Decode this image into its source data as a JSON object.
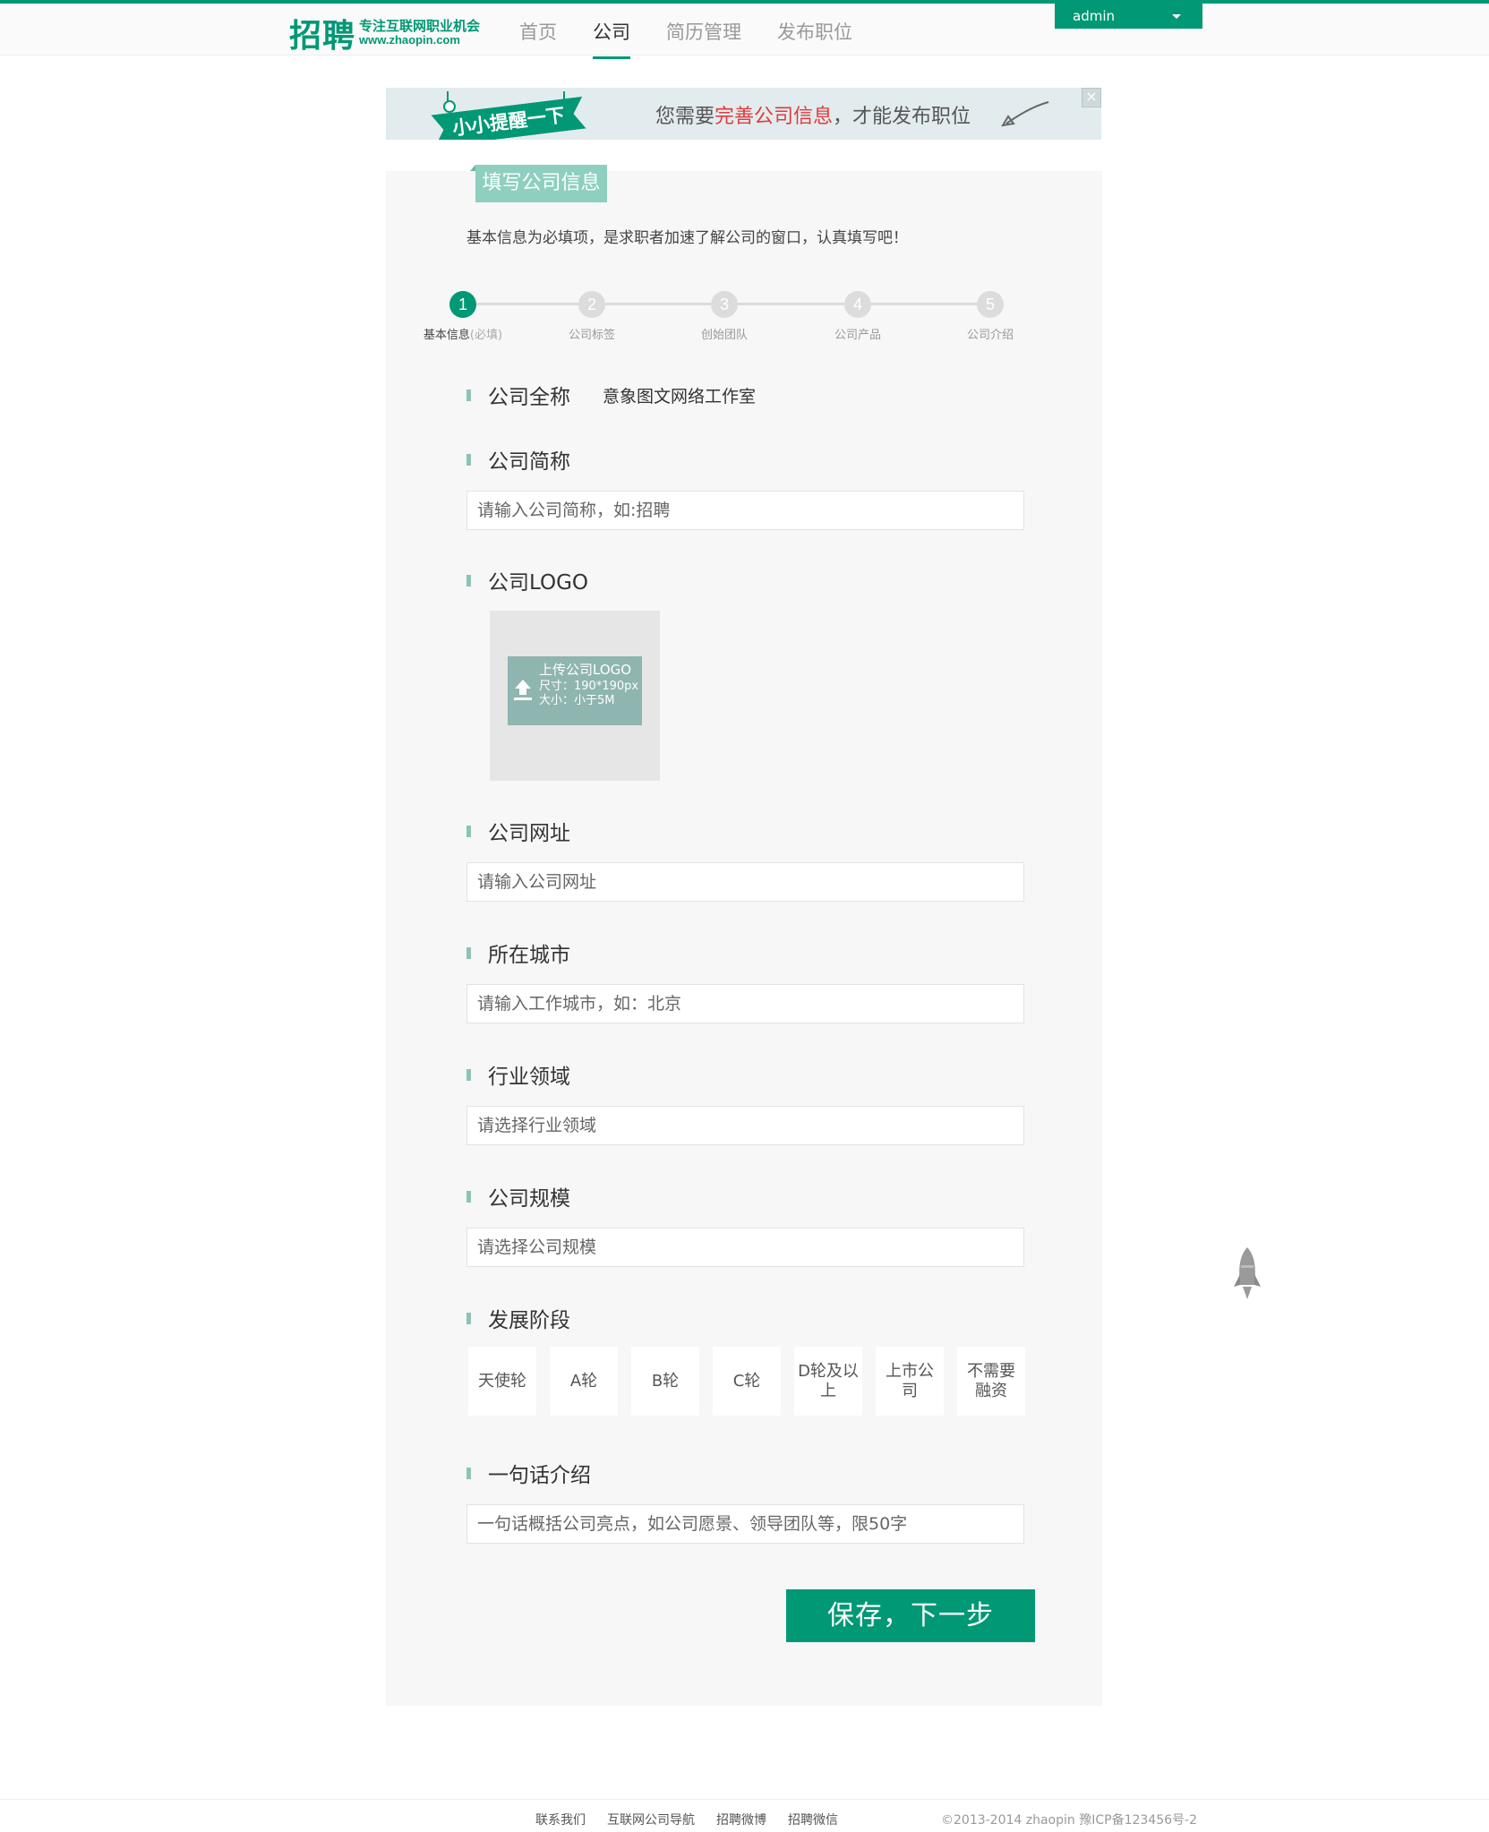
{
  "header": {
    "logo_main": "招聘",
    "logo_slogan": "专注互联网职业机会",
    "logo_url": "www.zhaopin.com",
    "nav": [
      "首页",
      "公司",
      "简历管理",
      "发布职位"
    ],
    "active_nav": "公司",
    "user": "admin",
    "brand_color": "#019875"
  },
  "banner": {
    "ribbon": "小小提醒一下",
    "text_before": "您需要",
    "text_highlight": "完善公司信息",
    "text_after": "，才能发布职位",
    "close_icon": "close-icon"
  },
  "card": {
    "tag": "填写公司信息",
    "intro": "基本信息为必填项，是求职者加速了解公司的窗口，认真填写吧！"
  },
  "steps": [
    {
      "num": "1",
      "label": "基本信息",
      "note": "(必填)",
      "done": true
    },
    {
      "num": "2",
      "label": "公司标签",
      "note": "",
      "done": false
    },
    {
      "num": "3",
      "label": "创始团队",
      "note": "",
      "done": false
    },
    {
      "num": "4",
      "label": "公司产品",
      "note": "",
      "done": false
    },
    {
      "num": "5",
      "label": "公司介绍",
      "note": "",
      "done": false
    }
  ],
  "fields": {
    "full_name": {
      "label": "公司全称",
      "value": "意象图文网络工作室"
    },
    "short_name": {
      "label": "公司简称",
      "placeholder": "请输入公司简称，如:招聘"
    },
    "logo": {
      "label": "公司LOGO",
      "upload_title": "上传公司LOGO",
      "upload_size": "尺寸：190*190px",
      "upload_limit": "大小：小于5M"
    },
    "website": {
      "label": "公司网址",
      "placeholder": "请输入公司网址"
    },
    "city": {
      "label": "所在城市",
      "placeholder": "请输入工作城市，如：北京"
    },
    "industry": {
      "label": "行业领域",
      "placeholder": "请选择行业领域"
    },
    "scale": {
      "label": "公司规模",
      "placeholder": "请选择公司规模"
    },
    "stage": {
      "label": "发展阶段",
      "options": [
        "天使轮",
        "A轮",
        "B轮",
        "C轮",
        "D轮及以上",
        "上市公司",
        "不需要融资"
      ]
    },
    "intro": {
      "label": "一句话介绍",
      "placeholder": "一句话概括公司亮点，如公司愿景、领导团队等，限50字"
    }
  },
  "actions": {
    "save": "保存，下一步"
  },
  "footer": {
    "links": [
      "联系我们",
      "互联网公司导航",
      "招聘微博",
      "招聘微信"
    ],
    "copyright": "©2013-2014 zhaopin    豫ICP备123456号-2"
  }
}
